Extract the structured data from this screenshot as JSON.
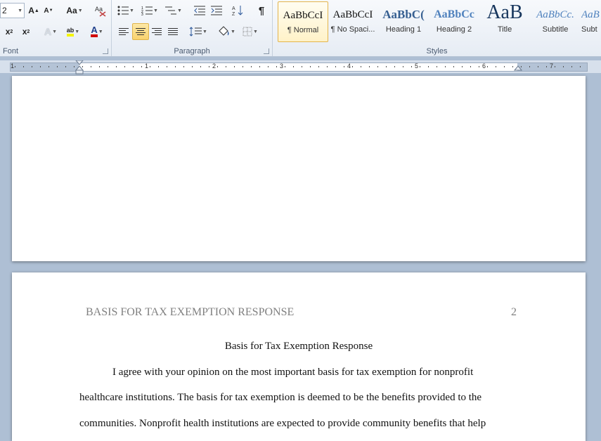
{
  "ribbon": {
    "font": {
      "size_value": "2",
      "change_case_label": "Aa",
      "group_label": "Font"
    },
    "paragraph": {
      "group_label": "Paragraph",
      "show_marks_glyph": "¶"
    },
    "styles": {
      "group_label": "Styles",
      "items": [
        {
          "preview": "AaBbCcI",
          "name": "¶ Normal",
          "selected": true
        },
        {
          "preview": "AaBbCcI",
          "name": "¶ No Spaci..."
        },
        {
          "preview": "AaBbC(",
          "name": "Heading 1"
        },
        {
          "preview": "AaBbCc",
          "name": "Heading 2"
        },
        {
          "preview": "AaB",
          "name": "Title"
        },
        {
          "preview": "AaBbCc.",
          "name": "Subtitle"
        },
        {
          "preview": "AaB",
          "name": "Subt"
        }
      ]
    }
  },
  "ruler": {
    "numbers": [
      "1",
      "1",
      "2",
      "3",
      "4",
      "5",
      "6",
      "7"
    ]
  },
  "document": {
    "page2": {
      "header_title": "BASIS FOR TAX EXEMPTION RESPONSE",
      "page_number": "2",
      "title": "Basis for Tax Exemption Response",
      "lines": [
        "I agree with your opinion on the most important basis for tax exemption for nonprofit",
        "healthcare institutions. The basis for tax exemption is deemed to be the benefits provided to the",
        "communities.  Nonprofit health institutions are expected to provide community benefits that help"
      ]
    }
  },
  "colors": {
    "highlight": "#f5f500",
    "font_color": "#d00000",
    "accent": "#2b579a"
  }
}
